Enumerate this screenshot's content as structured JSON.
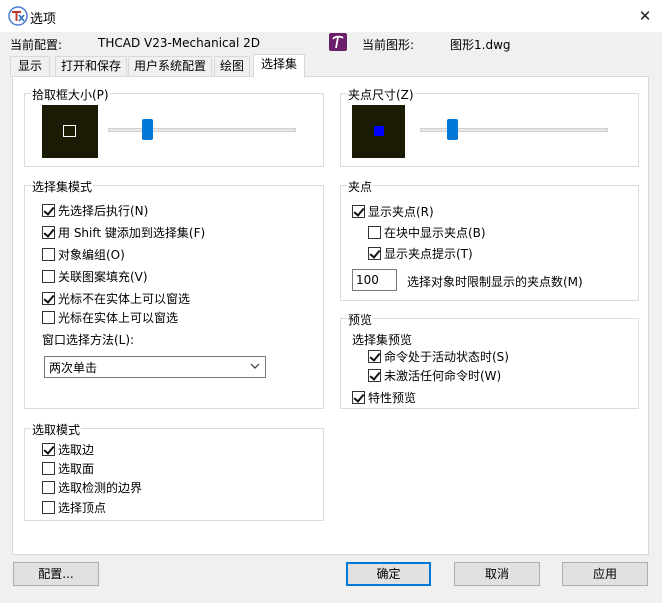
{
  "window": {
    "title": "选项",
    "close_glyph": "✕"
  },
  "profile": {
    "label": "当前配置:",
    "value": "THCAD V23-Mechanical 2D"
  },
  "drawing": {
    "label": "当前图形:",
    "value": "图形1.dwg"
  },
  "tabs": [
    {
      "label": "显示"
    },
    {
      "label": "打开和保存"
    },
    {
      "label": "用户系统配置"
    },
    {
      "label": "绘图"
    },
    {
      "label": "选择集",
      "active": true
    }
  ],
  "pickbox": {
    "legend": "拾取框大小(P)",
    "slider_fraction": 0.2
  },
  "grip_size": {
    "legend": "夹点尺寸(Z)",
    "slider_fraction": 0.17
  },
  "selection_modes": {
    "legend": "选择集模式",
    "items": [
      {
        "label": "先选择后执行(N)",
        "checked": true
      },
      {
        "label": "用 Shift 键添加到选择集(F)",
        "checked": true
      },
      {
        "label": "对象编组(O)",
        "checked": false
      },
      {
        "label": "关联图案填充(V)",
        "checked": false
      },
      {
        "label": "光标不在实体上可以窗选",
        "checked": true
      },
      {
        "label": "光标在实体上可以窗选",
        "checked": false
      }
    ],
    "window_method_label": "窗口选择方法(L):",
    "window_method_value": "两次单击"
  },
  "grips": {
    "legend": "夹点",
    "show_grips": {
      "label": "显示夹点(R)",
      "checked": true
    },
    "show_in_blocks": {
      "label": "在块中显示夹点(B)",
      "checked": false
    },
    "show_grip_tips": {
      "label": "显示夹点提示(T)",
      "checked": true
    },
    "limit_value": "100",
    "limit_label": "选择对象时限制显示的夹点数(M)"
  },
  "preview": {
    "legend": "预览",
    "selection_preview_label": "选择集预览",
    "cmd_active": {
      "label": "命令处于活动状态时(S)",
      "checked": true
    },
    "no_cmd": {
      "label": "未激活任何命令时(W)",
      "checked": true
    },
    "property_preview": {
      "label": "特性预览",
      "checked": true
    }
  },
  "pick_mode": {
    "legend": "选取模式",
    "items": [
      {
        "label": "选取边",
        "checked": true
      },
      {
        "label": "选取面",
        "checked": false
      },
      {
        "label": "选取检测的边界",
        "checked": false
      },
      {
        "label": "选择顶点",
        "checked": false
      }
    ]
  },
  "buttons": {
    "config": "配置...",
    "ok": "确定",
    "cancel": "取消",
    "apply": "应用"
  },
  "colors": {
    "accent": "#0078d7",
    "preview_bg": "#1a1a05",
    "grip_square": "#0000ff"
  }
}
